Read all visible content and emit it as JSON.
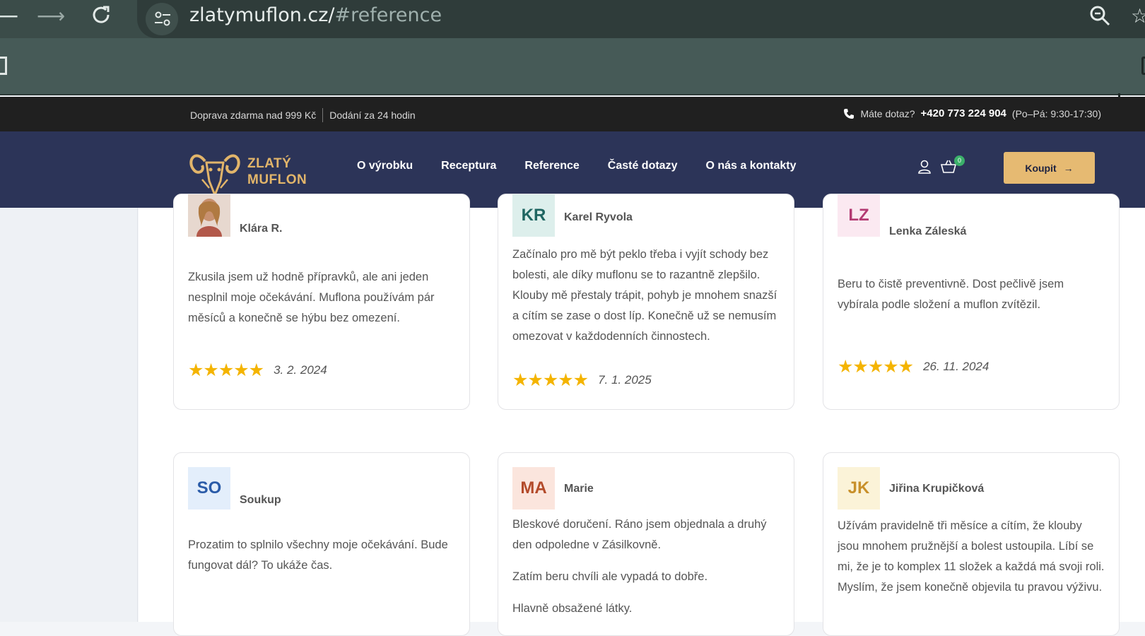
{
  "browser": {
    "url_host": "zlatymuflon.cz/",
    "url_path": "#reference",
    "back_icon": "arrow-left-icon",
    "forward_icon": "arrow-right-icon",
    "reload_icon": "reload-icon"
  },
  "topbar": {
    "shipping": "Doprava zdarma nad 999 Kč",
    "delivery": "Dodání za 24 hodin",
    "question": "Máte dotaz?",
    "phone": "+420 773 224 904",
    "hours": "(Po–Pá: 9:30-17:30)"
  },
  "nav": {
    "logo_line1": "ZLATÝ",
    "logo_line2": "MUFLON",
    "items": [
      "O výrobku",
      "Receptura",
      "Reference",
      "Časté dotazy",
      "O nás a kontakty"
    ],
    "cart_count": "0",
    "buy_label": "Koupit"
  },
  "reviews": [
    {
      "initials": "",
      "name": "Klára R.",
      "text": [
        "Zkusila jsem už hodně přípravků, ale ani jeden nesplnil moje očekávání. Muflona používám pár měsíců a konečně se hýbu bez omezení."
      ],
      "stars": "★★★★★",
      "rating": 5,
      "date": "3. 2. 2024"
    },
    {
      "initials": "KR",
      "name": "Karel Ryvola",
      "text": [
        "Začínalo pro mě být peklo třeba i vyjít schody bez bolesti, ale díky muflonu se to razantně zlepšilo. Klouby mě přestaly trápit, pohyb je mnohem snazší a cítím se zase o dost líp. Konečně už se nemusím omezovat v každodenních činnostech."
      ],
      "stars": "★★★★★",
      "rating": 5,
      "date": "7. 1. 2025"
    },
    {
      "initials": "LZ",
      "name": "Lenka Záleská",
      "text": [
        "Beru to čistě preventivně. Dost pečlivě jsem vybírala podle složení a muflon zvítězil."
      ],
      "stars": "★★★★★",
      "rating": 5,
      "date": "26. 11. 2024"
    },
    {
      "initials": "SO",
      "name": "Soukup",
      "text": [
        "Prozatim to splnilo všechny moje očekávání. Bude fungovat dál? To ukáže čas."
      ]
    },
    {
      "initials": "MA",
      "name": "Marie",
      "text": [
        "Bleskové doručení. Ráno jsem objednala a druhý den odpoledne v Zásilkovně.",
        "Zatím beru chvíli ale vypadá to dobře.",
        "Hlavně obsažené látky."
      ]
    },
    {
      "initials": "JK",
      "name": "Jiřina Krupičková",
      "text": [
        "Užívám pravidelně tři měsíce a cítím, že klouby jsou mnohem pružnější a bolest ustoupila. Líbí se mi, že je to komplex 11 složek a každá má svoji roli. Myslím, že jsem konečně objevila tu pravou výživu."
      ]
    }
  ],
  "colors": {
    "nav_bg": "#2c3458",
    "accent": "#e6ba72",
    "star": "#f4b400"
  }
}
